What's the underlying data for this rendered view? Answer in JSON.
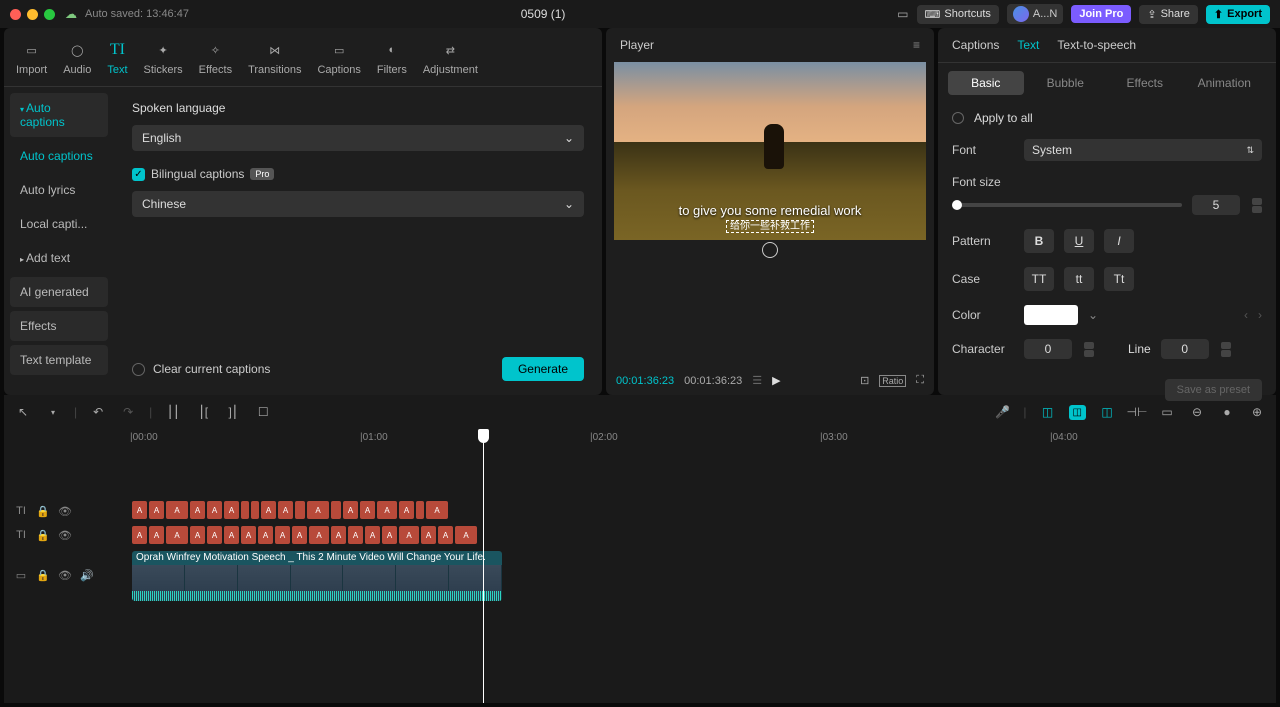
{
  "titlebar": {
    "autosave": "Auto saved: 13:46:47",
    "title": "0509 (1)",
    "shortcuts": "Shortcuts",
    "user": "A...N",
    "join_pro": "Join Pro",
    "share": "Share",
    "export": "Export"
  },
  "tools": {
    "import": "Import",
    "audio": "Audio",
    "text": "Text",
    "stickers": "Stickers",
    "effects": "Effects",
    "transitions": "Transitions",
    "captions": "Captions",
    "filters": "Filters",
    "adjustment": "Adjustment"
  },
  "nav": {
    "auto_captions_h": "Auto captions",
    "auto_captions": "Auto captions",
    "auto_lyrics": "Auto lyrics",
    "local_capti": "Local capti...",
    "add_text": "Add text",
    "ai_generated": "AI generated",
    "effects": "Effects",
    "text_template": "Text template"
  },
  "content": {
    "spoken_lang": "Spoken language",
    "english": "English",
    "bilingual": "Bilingual captions",
    "pro": "Pro",
    "chinese": "Chinese",
    "clear": "Clear current captions",
    "generate": "Generate"
  },
  "player": {
    "label": "Player",
    "cap1": "to give you some remedial work",
    "cap2": "给你一些补救工作",
    "cur": "00:01:36:23",
    "tot": "00:01:36:23",
    "ratio": "Ratio"
  },
  "inspector": {
    "captions": "Captions",
    "text": "Text",
    "tts": "Text-to-speech",
    "basic": "Basic",
    "bubble": "Bubble",
    "effects": "Effects",
    "animation": "Animation",
    "apply_all": "Apply to all",
    "font": "Font",
    "system": "System",
    "font_size": "Font size",
    "size_val": "5",
    "pattern": "Pattern",
    "case": "Case",
    "color": "Color",
    "character": "Character",
    "char_val": "0",
    "line": "Line",
    "line_val": "0",
    "save_preset": "Save as preset"
  },
  "timeline": {
    "t0": "00:00",
    "t1": "01:00",
    "t2": "02:00",
    "t3": "03:00",
    "t4": "04:00",
    "clip_title": "Oprah Winfrey Motivation Speech _ This 2 Minute Video Will Change Your Life."
  }
}
